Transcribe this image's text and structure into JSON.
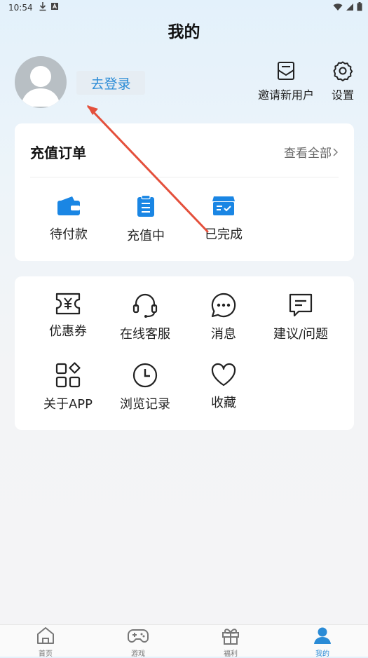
{
  "status_bar": {
    "time": "10:54"
  },
  "header": {
    "title": "我的"
  },
  "profile": {
    "login_label": "去登录"
  },
  "top_actions": {
    "invite_label": "邀请新用户",
    "settings_label": "设置"
  },
  "orders": {
    "title": "充值订单",
    "view_all_label": "查看全部",
    "items": [
      {
        "label": "待付款",
        "icon": "wallet-icon"
      },
      {
        "label": "充值中",
        "icon": "clipboard-icon"
      },
      {
        "label": "已完成",
        "icon": "completed-box-icon"
      }
    ]
  },
  "services": {
    "items": [
      {
        "label": "优惠券",
        "icon": "coupon-icon"
      },
      {
        "label": "在线客服",
        "icon": "headset-icon"
      },
      {
        "label": "消息",
        "icon": "message-icon"
      },
      {
        "label": "建议/问题",
        "icon": "feedback-icon"
      },
      {
        "label": "关于APP",
        "icon": "apps-icon"
      },
      {
        "label": "浏览记录",
        "icon": "clock-icon"
      },
      {
        "label": "收藏",
        "icon": "heart-icon"
      }
    ]
  },
  "tabbar": {
    "tabs": [
      {
        "label": "首页",
        "icon": "home-icon"
      },
      {
        "label": "游戏",
        "icon": "gamepad-icon"
      },
      {
        "label": "福利",
        "icon": "gift-icon"
      },
      {
        "label": "我的",
        "icon": "user-icon"
      }
    ]
  },
  "colors": {
    "accent": "#2a8bd6",
    "card_bg": "#ffffff",
    "annotation_arrow": "#e4503c"
  }
}
